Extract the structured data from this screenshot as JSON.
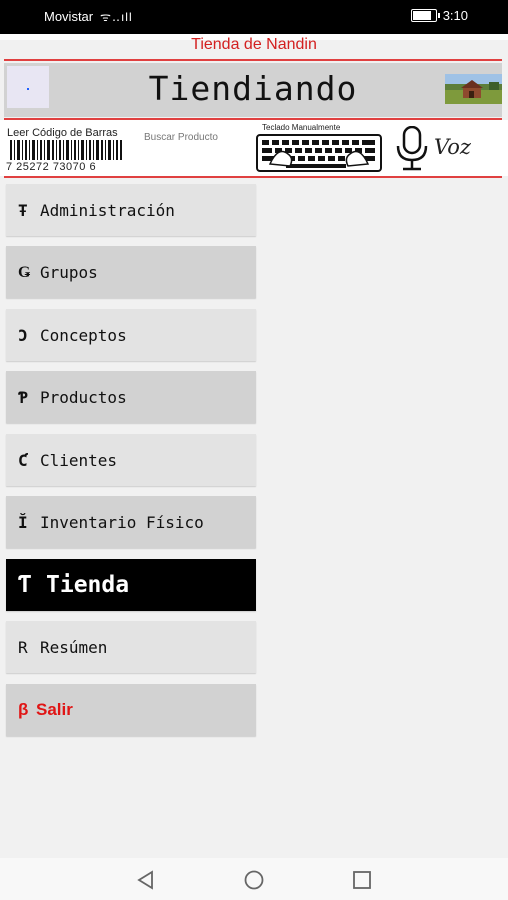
{
  "status_bar": {
    "carrier": "Movistar",
    "time": "3:10"
  },
  "header": {
    "store_name": "Tienda de Nandin",
    "app_title": "Tiendiando"
  },
  "tools": {
    "barcode_label": "Leer Código de Barras",
    "barcode_digits": "7  25272  73070  6",
    "search_label": "Buscar Producto",
    "keyboard_label": "Teclado Manualmente",
    "voice_label": "Voz"
  },
  "menu": [
    {
      "icon": "Ŧ",
      "label": "Administración"
    },
    {
      "icon": "Ǥ",
      "label": "Grupos"
    },
    {
      "icon": "Ɔ",
      "label": "Conceptos"
    },
    {
      "icon": "Ƥ",
      "label": "Productos"
    },
    {
      "icon": "Ƈ",
      "label": "Clientes"
    },
    {
      "icon": "Ĭ",
      "label": "Inventario Físico"
    },
    {
      "icon": "Ƭ",
      "label": "Tienda"
    },
    {
      "icon": "R",
      "label": "Resúmen"
    },
    {
      "icon": "β",
      "label": "Salir"
    }
  ],
  "colors": {
    "accent_red": "#d32020",
    "active_bg": "#000000",
    "exit_red": "#e01515"
  }
}
